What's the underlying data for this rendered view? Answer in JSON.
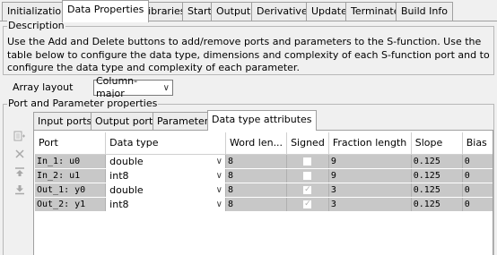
{
  "tabs": [
    "Initialization",
    "Data Properties",
    "Libraries",
    "Start",
    "Outputs",
    "Derivatives",
    "Update",
    "Terminate",
    "Build Info"
  ],
  "active_tab": "Data Properties",
  "description": {
    "title": "Description",
    "text": "Use the Add and Delete buttons to add/remove ports and parameters to the S-function. Use the table below to configure the data type, dimensions and complexity of each S-function port and to configure the data type and complexity of each parameter."
  },
  "array_layout": {
    "label": "Array layout",
    "value": "Column-major"
  },
  "port_group": {
    "title": "Port and Parameter properties",
    "side_buttons": [
      "add-icon",
      "delete-icon",
      "move-up-icon",
      "move-down-icon"
    ],
    "inner_tabs": [
      "Input ports",
      "Output ports",
      "Parameters",
      "Data type attributes"
    ],
    "active_inner_tab": "Data type attributes",
    "columns": [
      "Port",
      "Data type",
      "Word len...",
      "Signed",
      "Fraction length",
      "Slope",
      "Bias"
    ],
    "rows": [
      {
        "port": "In_1: u0",
        "data_type": "double",
        "word_length": "8",
        "signed": false,
        "fraction_length": "9",
        "slope": "0.125",
        "bias": "0"
      },
      {
        "port": "In_2: u1",
        "data_type": "int8",
        "word_length": "8",
        "signed": false,
        "fraction_length": "9",
        "slope": "0.125",
        "bias": "0"
      },
      {
        "port": "Out_1: y0",
        "data_type": "double",
        "word_length": "8",
        "signed": true,
        "fraction_length": "3",
        "slope": "0.125",
        "bias": "0"
      },
      {
        "port": "Out_2: y1",
        "data_type": "int8",
        "word_length": "8",
        "signed": true,
        "fraction_length": "3",
        "slope": "0.125",
        "bias": "0"
      }
    ]
  }
}
